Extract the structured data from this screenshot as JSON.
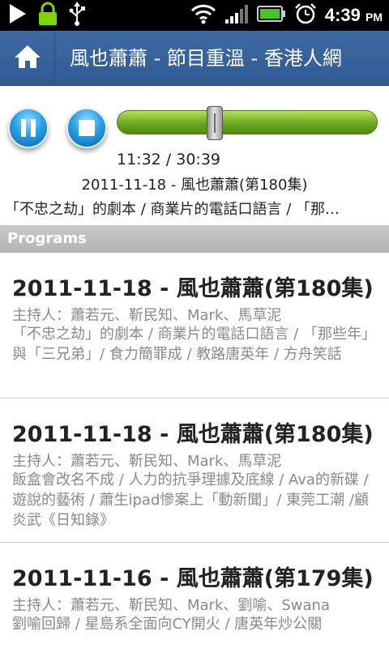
{
  "status_bar": {
    "icons_left": [
      "play-notification-icon",
      "lock-icon",
      "usb-icon"
    ],
    "icons_right": [
      "wifi-icon",
      "signal-icon",
      "battery-icon",
      "alarm-icon"
    ],
    "time": "4:39",
    "ampm": "PM"
  },
  "header": {
    "title": "風也蕭蕭 - 節目重溫 - 香港人網"
  },
  "player": {
    "progress_fraction": 0.376,
    "time_display": "11:32 / 30:39",
    "now_playing_title": "2011-11-18 - 風也蕭蕭(第180集)",
    "now_playing_desc": "「不忠之劫」的劇本 / 商業片的電話口語言 / 「那…"
  },
  "section": {
    "header": "Programs"
  },
  "programs": [
    {
      "title": "2011-11-18 - 風也蕭蕭(第180集)",
      "hosts": "主持人：蕭若元、靳民知、Mark、馬草泥",
      "desc": "「不忠之劫」的劇本 / 商業片的電話口語言 / 「那些年」與「三兄弟」/ 食力簡罪成 / 教路唐英年 / 方舟笑話"
    },
    {
      "title": "2011-11-18 - 風也蕭蕭(第180集)",
      "hosts": "主持人：蕭若元、靳民知、Mark、馬草泥",
      "desc": "飯盒會改名不成 / 人力的抗爭理據及底線 / Ava的新碟 / 遊說的藝術 / 蕭生ipad慘案上「動新聞」/ 東莞工潮 /顧炎武《日知錄》"
    },
    {
      "title": "2011-11-16 - 風也蕭蕭(第179集)",
      "hosts": "主持人：蕭若元、靳民知、Mark、劉喻、Swana",
      "desc": "劉喻回歸 / 星島系全面向CY開火 / 唐英年炒公關"
    }
  ]
}
